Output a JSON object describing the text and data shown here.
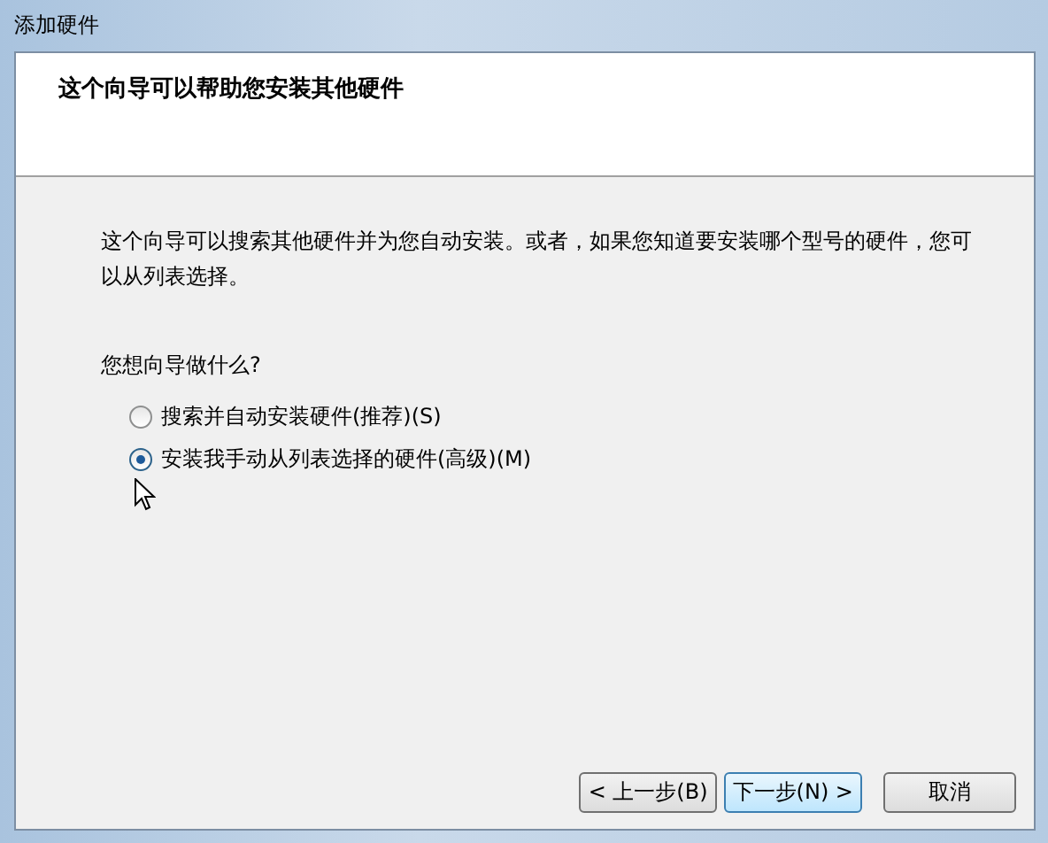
{
  "window": {
    "title": "添加硬件"
  },
  "header": {
    "title": "这个向导可以帮助您安装其他硬件"
  },
  "description": "这个向导可以搜索其他硬件并为您自动安装。或者，如果您知道要安装哪个型号的硬件，您可以从列表选择。",
  "question": "您想向导做什么?",
  "options": [
    {
      "label": "搜索并自动安装硬件(推荐)(S)",
      "selected": false
    },
    {
      "label": "安装我手动从列表选择的硬件(高级)(M)",
      "selected": true
    }
  ],
  "buttons": [
    {
      "label": "< 上一步(B)",
      "default": false
    },
    {
      "label": "下一步(N) >",
      "default": true
    },
    {
      "label": "取消",
      "default": false
    }
  ]
}
